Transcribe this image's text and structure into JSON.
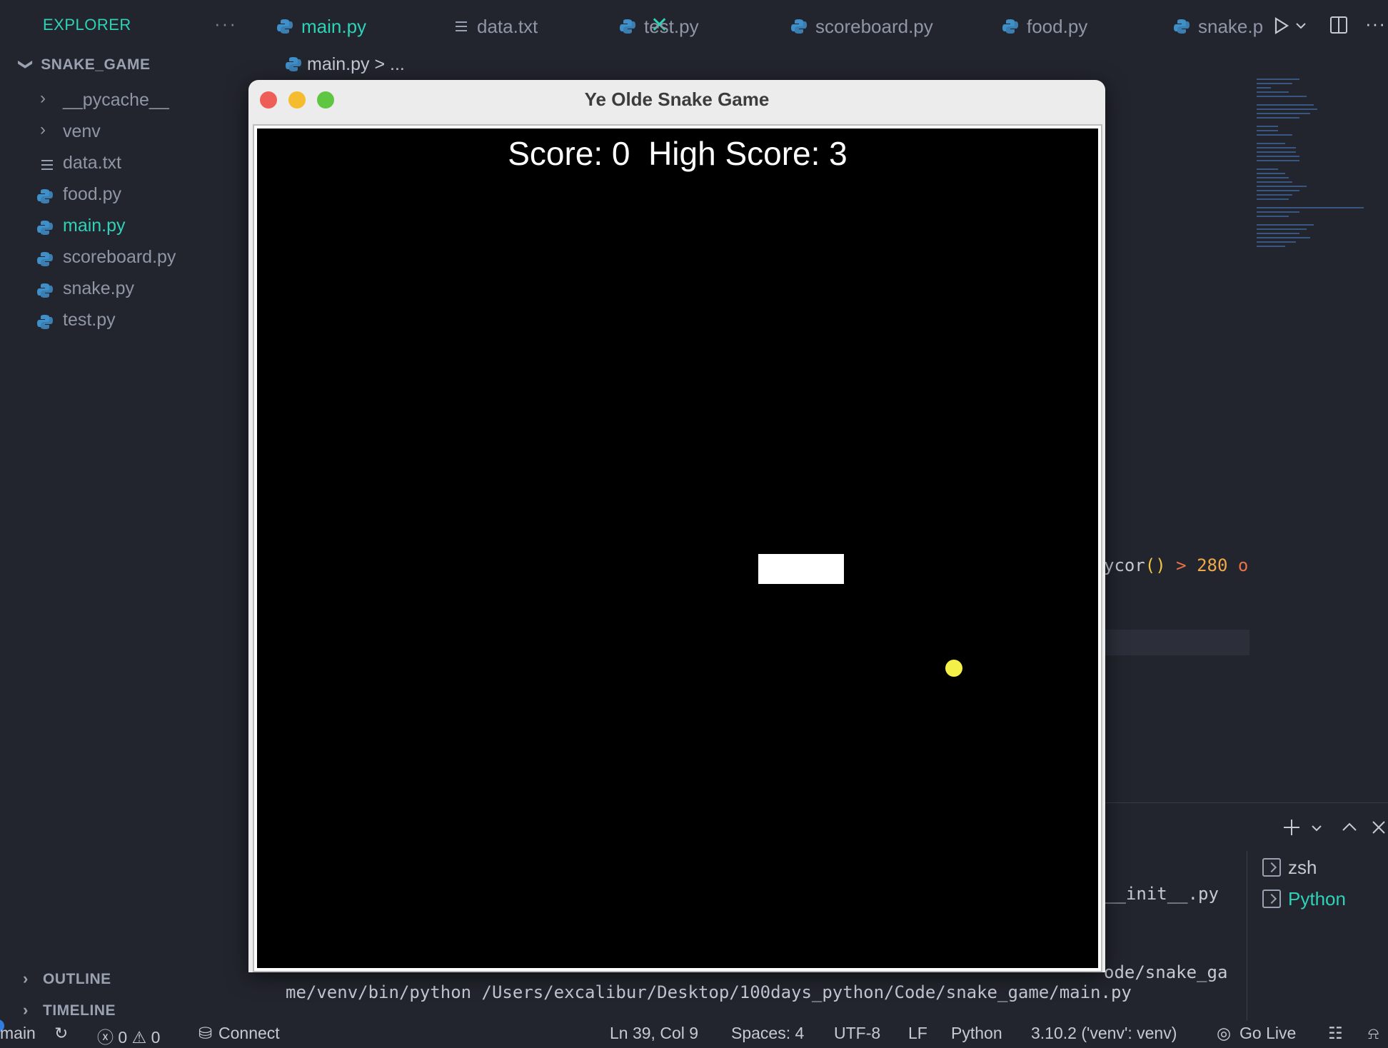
{
  "explorer": {
    "title": "EXPLORER",
    "more": "···",
    "folder": "SNAKE_GAME",
    "items": [
      {
        "label": "__pycache__",
        "type": "folder"
      },
      {
        "label": "venv",
        "type": "folder"
      },
      {
        "label": "data.txt",
        "type": "text"
      },
      {
        "label": "food.py",
        "type": "python"
      },
      {
        "label": "main.py",
        "type": "python",
        "active": true
      },
      {
        "label": "scoreboard.py",
        "type": "python"
      },
      {
        "label": "snake.py",
        "type": "python"
      },
      {
        "label": "test.py",
        "type": "python"
      }
    ],
    "outline": "OUTLINE",
    "timeline": "TIMELINE"
  },
  "tabs": [
    "main.py",
    "data.txt",
    "test.py",
    "scoreboard.py",
    "food.py",
    "snake.p"
  ],
  "breadcrumb": "main.py > ...",
  "editor": {
    "code_fragment": [
      "ycor",
      "()",
      " > ",
      "280",
      " o"
    ]
  },
  "terminal": {
    "line_partial": "__init__.py",
    "line_partial2": "ode/snake_ga",
    "line_full": "me/venv/bin/python /Users/excalibur/Desktop/100days_python/Code/snake_game/main.py",
    "sessions": [
      "zsh",
      "Python"
    ]
  },
  "statusbar": {
    "branch": "main",
    "problems": "ⓧ 0 ⚠ 0",
    "connect": "Connect",
    "position": "Ln 39, Col 9",
    "spaces": "Spaces: 4",
    "encoding": "UTF-8",
    "eol": "LF",
    "language": "Python",
    "interpreter": "3.10.2 ('venv': venv)",
    "golive": "Go Live"
  },
  "game_window": {
    "title": "Ye Olde Snake Game",
    "score_text": "Score: 0  High Score: 3"
  },
  "colors": {
    "accent": "#2ed3b7",
    "food": "#f4f04a",
    "snake": "#ffffff",
    "canvas": "#000000",
    "close": "#ee5e57",
    "minimize": "#f5bc2f",
    "zoom": "#5ec640"
  }
}
